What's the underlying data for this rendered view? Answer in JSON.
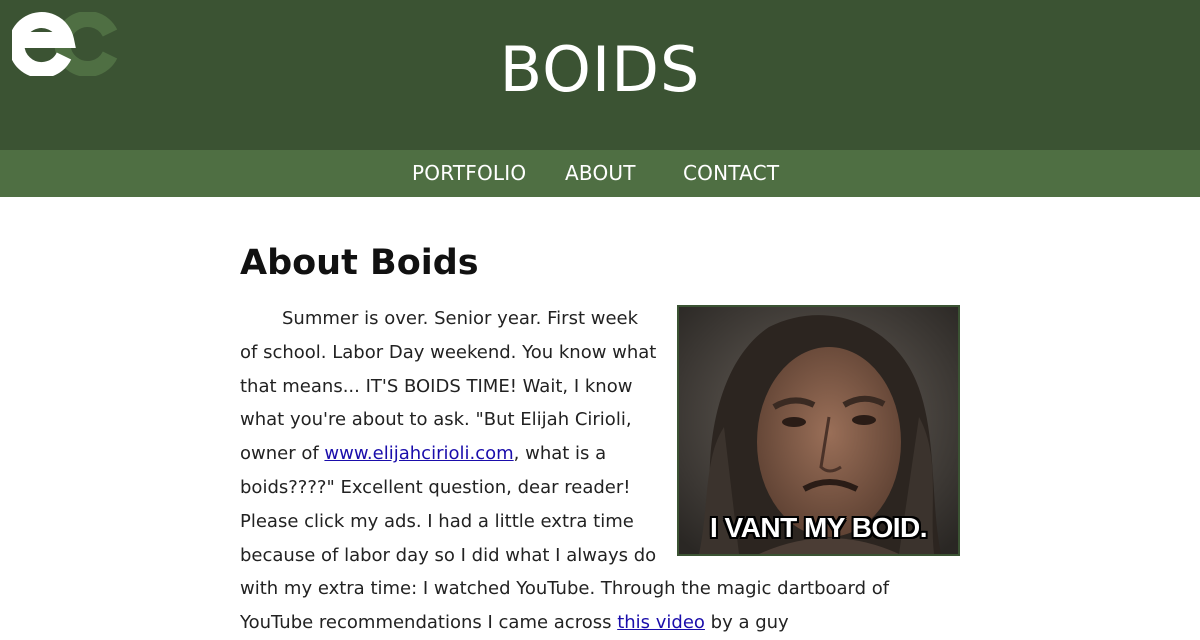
{
  "header": {
    "logo_text": "ec",
    "site_title": "BOIDS"
  },
  "nav": {
    "items": [
      {
        "label": "PORTFOLIO"
      },
      {
        "label": "ABOUT"
      },
      {
        "label": "CONTACT"
      }
    ]
  },
  "article": {
    "heading": "About Boids",
    "paragraph": {
      "text_before_link1": "Summer is over. Senior year. First week of school. Labor Day weekend. You know what that means... IT'S BOIDS TIME! Wait, I know what you're about to ask. \"But Elijah Cirioli, owner of ",
      "link1_text": "www.elijahcirioli.com",
      "text_between_links": ", what is a boids????\" Excellent question, dear reader! Please click my ads. I had a little extra time because of labor day so I did what I always do with my extra time: I watched YouTube. Through the magic dartboard of YouTube recommendations I came across ",
      "link2_text": "this video",
      "text_after_link2": " by a guy"
    },
    "image": {
      "caption": "I VANT MY BOID."
    }
  },
  "colors": {
    "header_bg": "#3b5333",
    "nav_bg": "#4f6f43",
    "link": "#1a0dab"
  }
}
